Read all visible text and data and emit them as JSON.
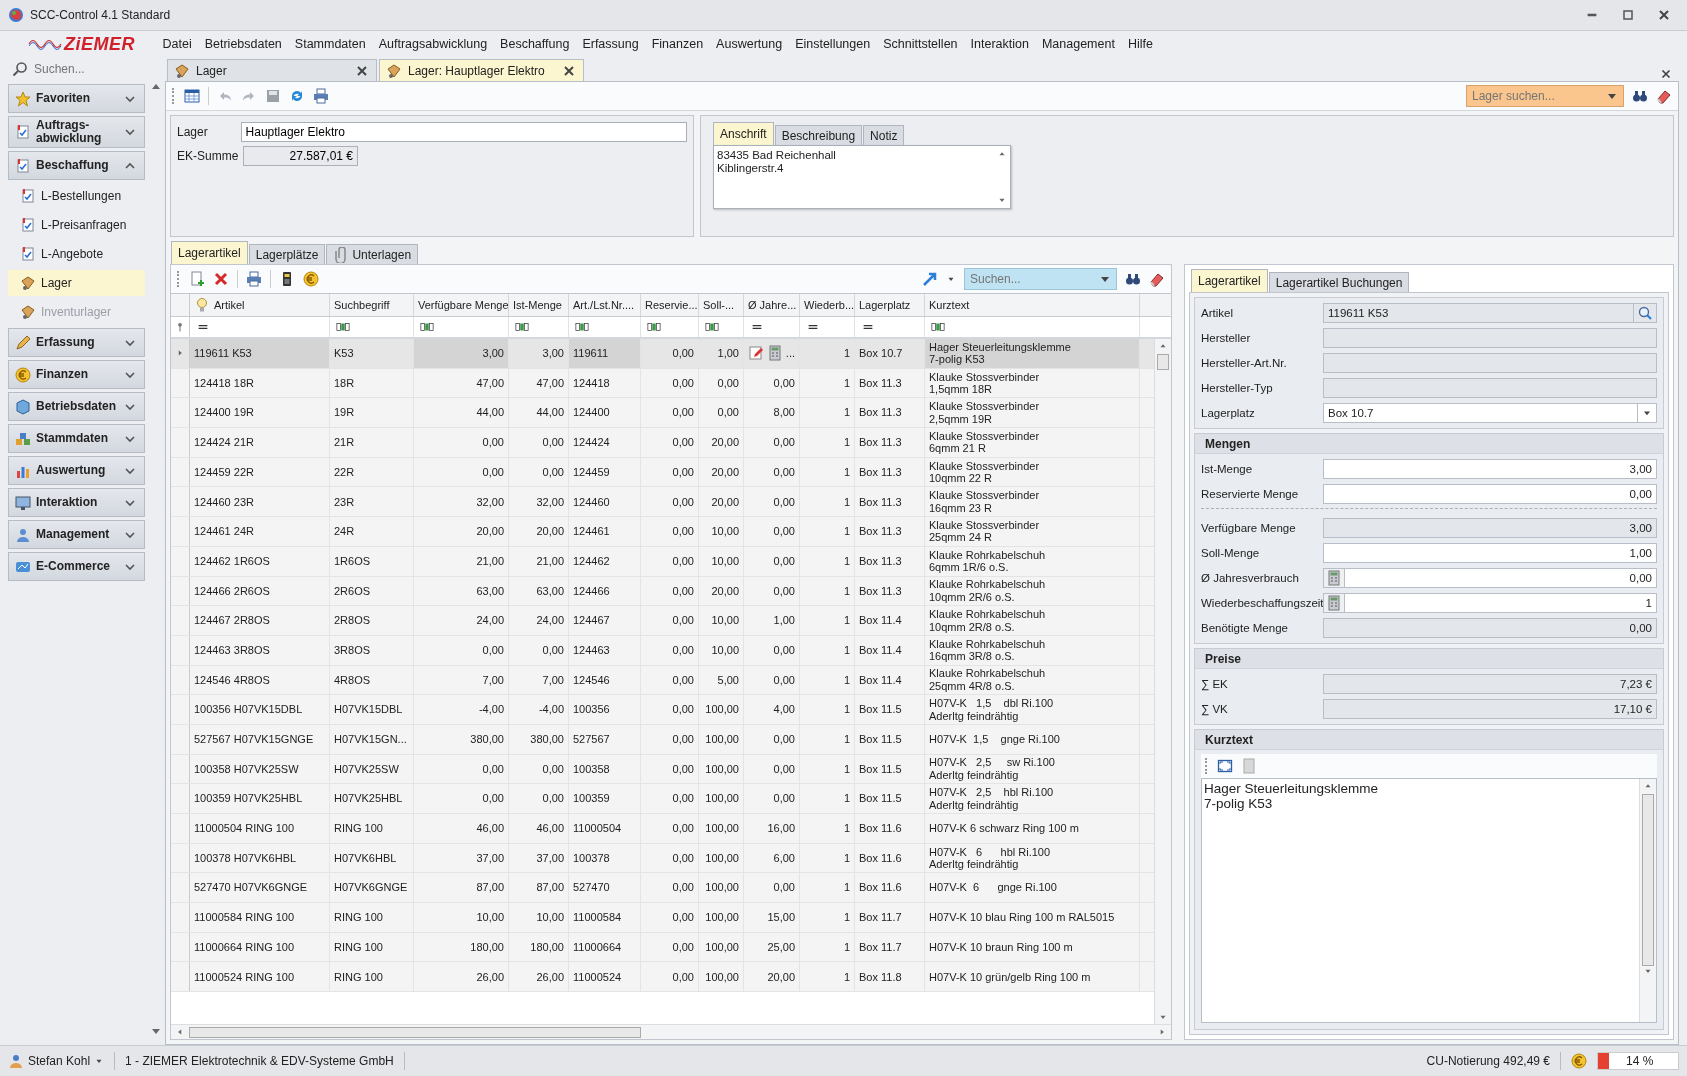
{
  "window": {
    "title": "SCC-Control 4.1 Standard"
  },
  "logo": {
    "text": "ZiEMER"
  },
  "menu": [
    "Datei",
    "Betriebsdaten",
    "Stammdaten",
    "Auftragsabwicklung",
    "Beschaffung",
    "Erfassung",
    "Finanzen",
    "Auswertung",
    "Einstellungen",
    "Schnittstellen",
    "Interaktion",
    "Management",
    "Hilfe"
  ],
  "sidebar": {
    "search_placeholder": "Suchen...",
    "groups": [
      {
        "label": "Favoriten",
        "expanded": false
      },
      {
        "label": "Auftrags-\nabwicklung",
        "expanded": false
      },
      {
        "label": "Beschaffung",
        "expanded": true,
        "items": [
          {
            "label": "L-Bestellungen",
            "selected": false,
            "disabled": false
          },
          {
            "label": "L-Preisanfragen",
            "selected": false,
            "disabled": false
          },
          {
            "label": "L-Angebote",
            "selected": false,
            "disabled": false
          },
          {
            "label": "Lager",
            "selected": true,
            "disabled": false
          },
          {
            "label": "Inventurlager",
            "selected": false,
            "disabled": true
          }
        ]
      },
      {
        "label": "Erfassung",
        "expanded": false
      },
      {
        "label": "Finanzen",
        "expanded": false
      },
      {
        "label": "Betriebsdaten",
        "expanded": false
      },
      {
        "label": "Stammdaten",
        "expanded": false
      },
      {
        "label": "Auswertung",
        "expanded": false
      },
      {
        "label": "Interaktion",
        "expanded": false
      },
      {
        "label": "Management",
        "expanded": false
      },
      {
        "label": "E-Commerce",
        "expanded": false
      }
    ]
  },
  "document_tabs": [
    {
      "label": "Lager",
      "selected": false
    },
    {
      "label": "Lager: Hauptlager Elektro",
      "selected": true
    }
  ],
  "toolbar": {
    "search_placeholder": "Lager suchen..."
  },
  "header_form": {
    "fields": [
      {
        "label": "Lager",
        "value": "Hauptlager Elektro",
        "readonly": false
      },
      {
        "label": "EK-Summe",
        "value": "27.587,01 €",
        "readonly": true
      }
    ]
  },
  "address_panel": {
    "tabs": [
      {
        "label": "Anschrift",
        "selected": true
      },
      {
        "label": "Beschreibung",
        "selected": false
      },
      {
        "label": "Notiz",
        "selected": false
      }
    ],
    "text": "83435 Bad Reichenhall\nKiblingerstr.4"
  },
  "content_tabs": [
    {
      "label": "Lagerartikel",
      "selected": true
    },
    {
      "label": "Lagerplätze",
      "selected": false
    },
    {
      "label": "Unterlagen",
      "selected": false
    }
  ],
  "grid": {
    "search_placeholder": "Suchen...",
    "columns": [
      {
        "label": "Artikel",
        "kind": "equals"
      },
      {
        "label": "Suchbegriff",
        "kind": "text"
      },
      {
        "label": "Verfügbare Menge",
        "kind": "text"
      },
      {
        "label": "Ist-Menge",
        "kind": "text"
      },
      {
        "label": "Art./Lst.Nr....",
        "kind": "text"
      },
      {
        "label": "Reservie...",
        "kind": "text"
      },
      {
        "label": "Soll-...",
        "kind": "text"
      },
      {
        "label": "Ø Jahre...",
        "kind": "equals"
      },
      {
        "label": "Wiederb...",
        "kind": "equals"
      },
      {
        "label": "Lagerplatz",
        "kind": "equals"
      },
      {
        "label": "Kurztext",
        "kind": "text"
      }
    ],
    "rows": [
      {
        "selected": true,
        "editor_button": "...",
        "cells": [
          "119611 K53",
          "K53",
          "3,00",
          "3,00",
          "119611",
          "0,00",
          "1,00",
          null,
          "1",
          "Box 10.7",
          "Hager Steuerleitungsklemme\n7-polig K53"
        ]
      },
      {
        "selected": false,
        "cells": [
          "124418 18R",
          "18R",
          "47,00",
          "47,00",
          "124418",
          "0,00",
          "0,00",
          "0,00",
          "1",
          "Box 11.3",
          "Klauke Stossverbinder\n1,5qmm 18R"
        ]
      },
      {
        "selected": false,
        "cells": [
          "124400 19R",
          "19R",
          "44,00",
          "44,00",
          "124400",
          "0,00",
          "0,00",
          "8,00",
          "1",
          "Box 11.3",
          "Klauke Stossverbinder\n2,5qmm 19R"
        ]
      },
      {
        "selected": false,
        "cells": [
          "124424 21R",
          "21R",
          "0,00",
          "0,00",
          "124424",
          "0,00",
          "20,00",
          "0,00",
          "1",
          "Box 11.3",
          "Klauke Stossverbinder\n6qmm 21 R"
        ]
      },
      {
        "selected": false,
        "cells": [
          "124459 22R",
          "22R",
          "0,00",
          "0,00",
          "124459",
          "0,00",
          "20,00",
          "0,00",
          "1",
          "Box 11.3",
          "Klauke Stossverbinder\n10qmm 22 R"
        ]
      },
      {
        "selected": false,
        "cells": [
          "124460 23R",
          "23R",
          "32,00",
          "32,00",
          "124460",
          "0,00",
          "20,00",
          "0,00",
          "1",
          "Box 11.3",
          "Klauke Stossverbinder\n16qmm 23 R"
        ]
      },
      {
        "selected": false,
        "cells": [
          "124461 24R",
          "24R",
          "20,00",
          "20,00",
          "124461",
          "0,00",
          "10,00",
          "0,00",
          "1",
          "Box 11.3",
          "Klauke Stossverbinder\n25qmm 24 R"
        ]
      },
      {
        "selected": false,
        "cells": [
          "124462 1R6OS",
          "1R6OS",
          "21,00",
          "21,00",
          "124462",
          "0,00",
          "10,00",
          "0,00",
          "1",
          "Box 11.3",
          "Klauke Rohrkabelschuh\n6qmm 1R/6 o.S."
        ]
      },
      {
        "selected": false,
        "cells": [
          "124466 2R6OS",
          "2R6OS",
          "63,00",
          "63,00",
          "124466",
          "0,00",
          "20,00",
          "0,00",
          "1",
          "Box 11.3",
          "Klauke Rohrkabelschuh\n10qmm 2R/6 o.S."
        ]
      },
      {
        "selected": false,
        "cells": [
          "124467 2R8OS",
          "2R8OS",
          "24,00",
          "24,00",
          "124467",
          "0,00",
          "10,00",
          "1,00",
          "1",
          "Box 11.4",
          "Klauke Rohrkabelschuh\n10qmm 2R/8 o.S."
        ]
      },
      {
        "selected": false,
        "cells": [
          "124463 3R8OS",
          "3R8OS",
          "0,00",
          "0,00",
          "124463",
          "0,00",
          "10,00",
          "0,00",
          "1",
          "Box 11.4",
          "Klauke Rohrkabelschuh\n16qmm 3R/8 o.S."
        ]
      },
      {
        "selected": false,
        "cells": [
          "124546 4R8OS",
          "4R8OS",
          "7,00",
          "7,00",
          "124546",
          "0,00",
          "5,00",
          "0,00",
          "1",
          "Box 11.4",
          "Klauke Rohrkabelschuh\n25qmm 4R/8 o.S."
        ]
      },
      {
        "selected": false,
        "cells": [
          "100356 H07VK15DBL",
          "H07VK15DBL",
          "-4,00",
          "-4,00",
          "100356",
          "0,00",
          "100,00",
          "4,00",
          "1",
          "Box 11.5",
          "H07V-K   1,5    dbl Ri.100\nAderltg feindrähtig"
        ]
      },
      {
        "selected": false,
        "cells": [
          "527567 H07VK15GNGE",
          "H07VK15GN...",
          "380,00",
          "380,00",
          "527567",
          "0,00",
          "100,00",
          "0,00",
          "1",
          "Box 11.5",
          "H07V-K  1,5    gnge Ri.100"
        ]
      },
      {
        "selected": false,
        "cells": [
          "100358 H07VK25SW",
          "H07VK25SW",
          "0,00",
          "0,00",
          "100358",
          "0,00",
          "100,00",
          "0,00",
          "1",
          "Box 11.5",
          "H07V-K   2,5     sw Ri.100\nAderltg feindrähtig"
        ]
      },
      {
        "selected": false,
        "cells": [
          "100359 H07VK25HBL",
          "H07VK25HBL",
          "0,00",
          "0,00",
          "100359",
          "0,00",
          "100,00",
          "0,00",
          "1",
          "Box 11.5",
          "H07V-K   2,5    hbl Ri.100\nAderltg feindrähtig"
        ]
      },
      {
        "selected": false,
        "cells": [
          "11000504 RING 100",
          "RING 100",
          "46,00",
          "46,00",
          "11000504",
          "0,00",
          "100,00",
          "16,00",
          "1",
          "Box 11.6",
          "H07V-K 6 schwarz Ring 100 m"
        ]
      },
      {
        "selected": false,
        "cells": [
          "100378 H07VK6HBL",
          "H07VK6HBL",
          "37,00",
          "37,00",
          "100378",
          "0,00",
          "100,00",
          "6,00",
          "1",
          "Box 11.6",
          "H07V-K   6      hbl Ri.100\nAderltg feindrähtig"
        ]
      },
      {
        "selected": false,
        "cells": [
          "527470 H07VK6GNGE",
          "H07VK6GNGE",
          "87,00",
          "87,00",
          "527470",
          "0,00",
          "100,00",
          "0,00",
          "1",
          "Box 11.6",
          "H07V-K  6      gnge Ri.100"
        ]
      },
      {
        "selected": false,
        "cells": [
          "11000584 RING 100",
          "RING 100",
          "10,00",
          "10,00",
          "11000584",
          "0,00",
          "100,00",
          "15,00",
          "1",
          "Box 11.7",
          "H07V-K 10 blau Ring 100 m RAL5015"
        ]
      },
      {
        "selected": false,
        "cells": [
          "11000664 RING 100",
          "RING 100",
          "180,00",
          "180,00",
          "11000664",
          "0,00",
          "100,00",
          "25,00",
          "1",
          "Box 11.7",
          "H07V-K 10 braun Ring 100 m"
        ]
      },
      {
        "selected": false,
        "cells": [
          "11000524 RING 100",
          "RING 100",
          "26,00",
          "26,00",
          "11000524",
          "0,00",
          "100,00",
          "20,00",
          "1",
          "Box 11.8",
          "H07V-K 10 grün/gelb Ring 100 m"
        ]
      }
    ]
  },
  "detail": {
    "tabs": [
      {
        "label": "Lagerartikel",
        "selected": true
      },
      {
        "label": "Lagerartikel Buchungen",
        "selected": false
      }
    ],
    "groups": [
      {
        "fields": [
          {
            "label": "Artikel",
            "value": "119611 K53",
            "kind": "lookup",
            "readonly": true
          },
          {
            "label": "Hersteller",
            "kind": "text",
            "readonly": true
          },
          {
            "label": "Hersteller-Art.Nr.",
            "kind": "text",
            "readonly": true
          },
          {
            "label": "Hersteller-Typ",
            "kind": "text",
            "readonly": true
          },
          {
            "label": "Lagerplatz",
            "value": "Box 10.7",
            "kind": "combo",
            "readonly": false
          }
        ]
      },
      {
        "title": "Mengen",
        "fields": [
          {
            "label": "Ist-Menge",
            "value": "3,00",
            "kind": "number",
            "readonly": false
          },
          {
            "label": "Reservierte Menge",
            "value": "0,00",
            "kind": "number",
            "readonly": false,
            "divider_after": true
          },
          {
            "label": "Verfügbare Menge",
            "value": "3,00",
            "kind": "number",
            "readonly": true
          },
          {
            "label": "Soll-Menge",
            "value": "1,00",
            "kind": "number",
            "readonly": false
          },
          {
            "label": "Ø Jahresverbrauch",
            "value": "0,00",
            "kind": "calc",
            "readonly": false
          },
          {
            "label": "Wiederbeschaffungszeit",
            "value": "1",
            "kind": "calc",
            "readonly": false
          },
          {
            "label": "Benötigte Menge",
            "value": "0,00",
            "kind": "number",
            "readonly": true
          }
        ]
      },
      {
        "title": "Preise",
        "fields": [
          {
            "label": "∑ EK",
            "value": "7,23 €",
            "kind": "number",
            "readonly": true
          },
          {
            "label": "∑ VK",
            "value": "17,10 €",
            "kind": "number",
            "readonly": true
          }
        ]
      }
    ],
    "kurztext": {
      "title": "Kurztext",
      "text": "Hager Steuerleitungsklemme\n7-polig K53"
    }
  },
  "status_bar": {
    "user": "Stefan Kohl",
    "company": "1 - ZIEMER Elektrotechnik & EDV-Systeme GmbH",
    "quote": "CU-Notierung 492,49 €",
    "progress": {
      "level": 0.14,
      "reading": "14 %"
    }
  }
}
